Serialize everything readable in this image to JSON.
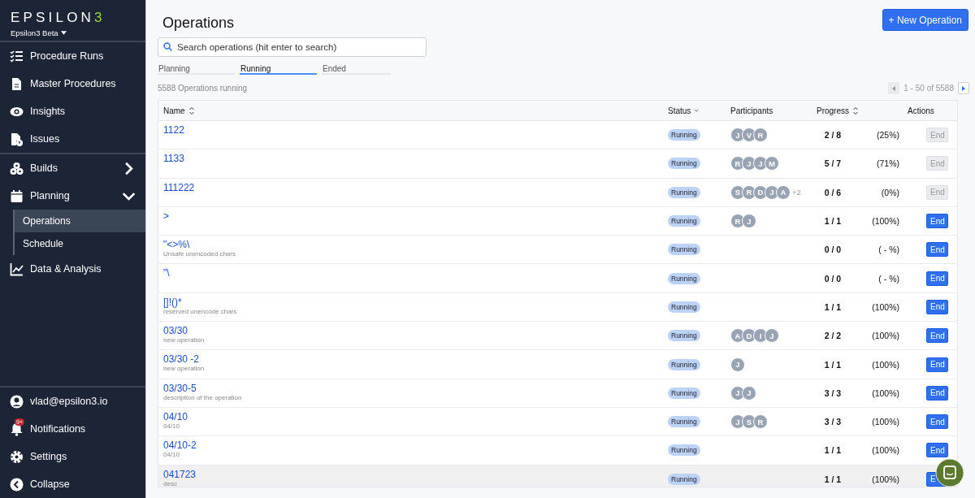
{
  "sidebar": {
    "logo": {
      "text": "EPSILON",
      "accent": "3"
    },
    "workspace": "Epsilon3 Beta",
    "items": [
      {
        "label": "Procedure Runs"
      },
      {
        "label": "Master Procedures"
      },
      {
        "label": "Insights"
      },
      {
        "label": "Issues"
      },
      {
        "label": "Builds",
        "expanded": false
      },
      {
        "label": "Planning",
        "expanded": true,
        "children": [
          {
            "label": "Operations",
            "selected": true
          },
          {
            "label": "Schedule",
            "selected": false
          }
        ]
      },
      {
        "label": "Data & Analysis"
      }
    ],
    "bottom_items": [
      {
        "label": "vlad@epsilon3.io"
      },
      {
        "label": "Notifications",
        "badge": "9+"
      },
      {
        "label": "Settings"
      },
      {
        "label": "Collapse"
      }
    ]
  },
  "page": {
    "title": "Operations",
    "new_button": "+ New Operation",
    "search": {
      "placeholder": "Search operations (hit enter to search)"
    },
    "tabs": [
      {
        "label": "Planning",
        "selected": false
      },
      {
        "label": "Running",
        "selected": true
      },
      {
        "label": "Ended",
        "selected": false
      }
    ],
    "count": "5588 Operations running",
    "pagination": {
      "range": "1 - 50 of 5588",
      "prev_disabled": true,
      "next_disabled": false
    }
  },
  "table": {
    "columns": [
      "Name",
      "Status",
      "Participants",
      "Progress",
      "Actions"
    ],
    "rows": [
      {
        "name": "1122",
        "status": "Running",
        "participants": [
          "J",
          "V",
          "R"
        ],
        "progress": "2 / 8",
        "percent": "(25%)",
        "action": "End",
        "disabled": true,
        "highlighted": false
      },
      {
        "name": "1133",
        "status": "Running",
        "participants": [
          "R",
          "J",
          "J",
          "M"
        ],
        "progress": "5 / 7",
        "percent": "(71%)",
        "action": "End",
        "disabled": true,
        "highlighted": false
      },
      {
        "name": "111222",
        "status": "Running",
        "participants": [
          "S",
          "R",
          "D",
          "J",
          "A"
        ],
        "more": "+2",
        "progress": "0 / 6",
        "percent": "(0%)",
        "action": "End",
        "disabled": true,
        "highlighted": false
      },
      {
        "name": ">",
        "status": "Running",
        "participants": [
          "R",
          "J"
        ],
        "progress": "1 / 1",
        "percent": "(100%)",
        "action": "End",
        "disabled": false,
        "highlighted": false
      },
      {
        "name": "\"<>%\\",
        "description": "Unsafe unencoded chars",
        "status": "Running",
        "participants": [],
        "progress": "0 / 0",
        "percent": "( - %)",
        "action": "End",
        "disabled": false,
        "highlighted": false
      },
      {
        "name": "\"\\",
        "status": "Running",
        "participants": [],
        "progress": "0 / 0",
        "percent": "( - %)",
        "action": "End",
        "disabled": false,
        "highlighted": false
      },
      {
        "name": "[]!()*",
        "description": "reserved unencode chars",
        "status": "Running",
        "participants": [],
        "progress": "1 / 1",
        "percent": "(100%)",
        "action": "End",
        "disabled": false,
        "highlighted": false
      },
      {
        "name": "03/30",
        "description": "new operation",
        "status": "Running",
        "participants": [
          "A",
          "D",
          "I",
          "J"
        ],
        "progress": "2 / 2",
        "percent": "(100%)",
        "action": "End",
        "disabled": false,
        "highlighted": false
      },
      {
        "name": "03/30 -2",
        "description": "new operation",
        "status": "Running",
        "participants": [
          "J"
        ],
        "progress": "1 / 1",
        "percent": "(100%)",
        "action": "End",
        "disabled": false,
        "highlighted": false
      },
      {
        "name": "03/30-5",
        "description": "description of the operation",
        "status": "Running",
        "participants": [
          "J",
          "J"
        ],
        "progress": "3 / 3",
        "percent": "(100%)",
        "action": "End",
        "disabled": false,
        "highlighted": false
      },
      {
        "name": "04/10",
        "description": "04/10",
        "status": "Running",
        "participants": [
          "J",
          "S",
          "R"
        ],
        "progress": "3 / 3",
        "percent": "(100%)",
        "action": "End",
        "disabled": false,
        "highlighted": false
      },
      {
        "name": "04/10-2",
        "description": "04/10",
        "status": "Running",
        "participants": [],
        "progress": "1 / 1",
        "percent": "(100%)",
        "action": "End",
        "disabled": false,
        "highlighted": false
      },
      {
        "name": "041723",
        "description": "desc",
        "status": "Running",
        "participants": [],
        "progress": "1 / 1",
        "percent": "(100%)",
        "action": "E",
        "disabled": false,
        "highlighted": true
      }
    ]
  }
}
